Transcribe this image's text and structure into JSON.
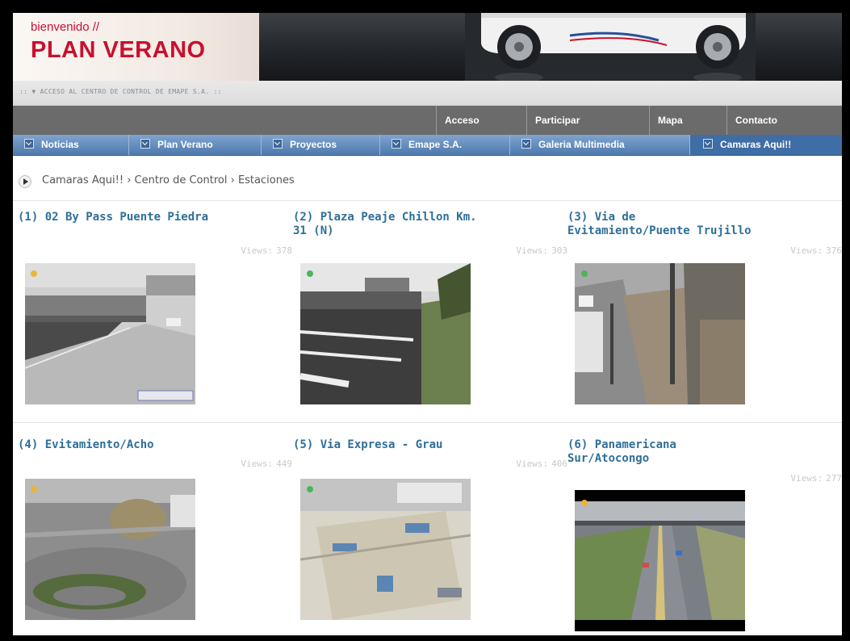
{
  "header": {
    "welcome": "bienvenido //",
    "brand": "PLAN VERANO",
    "tagline": ":: ▼ ACCESO AL CENTRO DE CONTROL DE EMAPE S.A. ::"
  },
  "top_nav": [
    "Acceso",
    "Participar",
    "Mapa",
    "Contacto"
  ],
  "main_nav": [
    "Noticias",
    "Plan Verano",
    "Proyectos",
    "Emape S.A.",
    "Galeria Multimedia",
    "Camaras Aqui!!"
  ],
  "breadcrumb": "Camaras Aqui!! › Centro de Control › Estaciones",
  "views_label": "Views:",
  "cameras": [
    {
      "title": "(1) 02 By Pass Puente Piedra",
      "views": "378"
    },
    {
      "title": "(2) Plaza Peaje Chillon Km. 31 (N)",
      "views": "303"
    },
    {
      "title": "(3) Via de Evitamiento/Puente Trujillo",
      "views": "376"
    },
    {
      "title": "(4) Evitamiento/Acho",
      "views": "449"
    },
    {
      "title": "(5) Via Expresa - Grau",
      "views": "406"
    },
    {
      "title": "(6) Panamericana Sur/Atocongo",
      "views": "277"
    }
  ],
  "colors": {
    "brand_red": "#c8102e",
    "nav_blue": "#4e79ad",
    "title_blue": "#2f6f98",
    "top_nav_gray": "#6b6b6b"
  }
}
